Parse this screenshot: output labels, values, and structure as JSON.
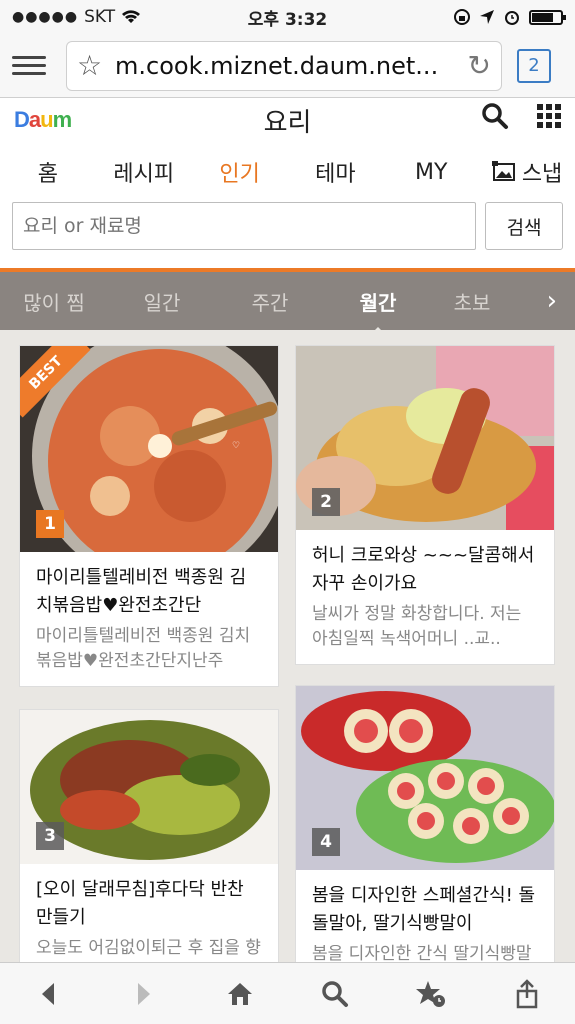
{
  "status_bar": {
    "carrier": "SKT",
    "signal": "●●●●●",
    "time": "오후 3:32"
  },
  "browser": {
    "url": "m.cook.miznet.daum.net...",
    "tab_count": "2"
  },
  "site": {
    "logo": {
      "d": "D",
      "a": "a",
      "u": "u",
      "m": "m"
    },
    "title": "요리"
  },
  "nav": {
    "items": [
      "홈",
      "레시피",
      "인기",
      "테마",
      "MY"
    ],
    "active_index": 2,
    "snap_label": "스냅"
  },
  "search": {
    "placeholder": "요리 or 재료명",
    "button_label": "검색"
  },
  "tabs": {
    "items": [
      "많이 찜",
      "일간",
      "주간",
      "월간",
      "초보"
    ],
    "active": "월간"
  },
  "cards": [
    {
      "rank": "1",
      "badge": "BEST",
      "title": "마이리틀텔레비전 백종원 김치볶음밥♥완전초간단",
      "desc": "마이리틀텔레비전 백종원 김치볶음밥♥완전초간단지난주"
    },
    {
      "rank": "2",
      "title": "허니 크로와상 ~~~달콤해서 자꾸 손이가요",
      "desc": "날씨가 정말 화창합니다. 저는 아침일찍 녹색어머니 ..교.."
    },
    {
      "rank": "3",
      "title": "[오이 달래무침]후다닥 반찬 만들기",
      "desc": "오늘도 어김없이퇴근 후 집을 향하였지요~ 오는 차 안"
    },
    {
      "rank": "4",
      "title": "봄을 디자인한 스페셜간식! 돌돌말아, 딸기식빵말이",
      "desc": "봄을 디자인한 간식 딸기식빵말이"
    }
  ],
  "colors": {
    "accent": "#e87722",
    "tab_bar": "#8a8480",
    "background": "#e9e7e3"
  }
}
